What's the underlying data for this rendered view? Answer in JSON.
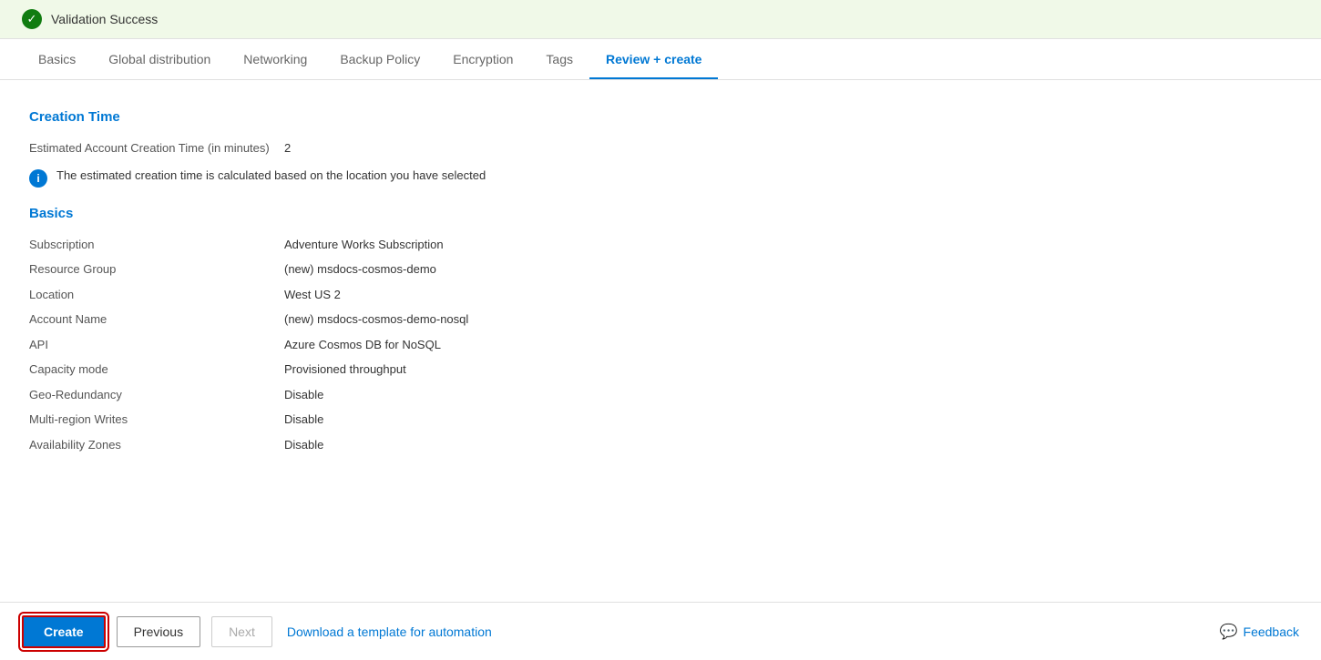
{
  "validation": {
    "status": "Validation Success",
    "icon": "✓"
  },
  "tabs": [
    {
      "id": "basics",
      "label": "Basics",
      "active": false
    },
    {
      "id": "global-distribution",
      "label": "Global distribution",
      "active": false
    },
    {
      "id": "networking",
      "label": "Networking",
      "active": false
    },
    {
      "id": "backup-policy",
      "label": "Backup Policy",
      "active": false
    },
    {
      "id": "encryption",
      "label": "Encryption",
      "active": false
    },
    {
      "id": "tags",
      "label": "Tags",
      "active": false
    },
    {
      "id": "review-create",
      "label": "Review + create",
      "active": true
    }
  ],
  "creation_time": {
    "section_title": "Creation Time",
    "estimated_label": "Estimated Account Creation Time (in minutes)",
    "estimated_value": "2",
    "notice_text": "The estimated creation time is calculated based on the location you have selected"
  },
  "basics": {
    "section_title": "Basics",
    "fields": [
      {
        "label": "Subscription",
        "value": "Adventure Works Subscription"
      },
      {
        "label": "Resource Group",
        "value": "(new) msdocs-cosmos-demo"
      },
      {
        "label": "Location",
        "value": "West US 2"
      },
      {
        "label": "Account Name",
        "value": "(new) msdocs-cosmos-demo-nosql"
      },
      {
        "label": "API",
        "value": "Azure Cosmos DB for NoSQL"
      },
      {
        "label": "Capacity mode",
        "value": "Provisioned throughput"
      },
      {
        "label": "Geo-Redundancy",
        "value": "Disable"
      },
      {
        "label": "Multi-region Writes",
        "value": "Disable"
      },
      {
        "label": "Availability Zones",
        "value": "Disable"
      }
    ]
  },
  "footer": {
    "create_label": "Create",
    "previous_label": "Previous",
    "next_label": "Next",
    "automation_link": "Download a template for automation",
    "feedback_label": "Feedback"
  }
}
